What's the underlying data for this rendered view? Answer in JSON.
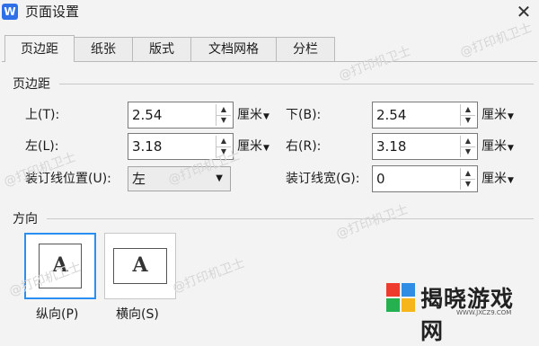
{
  "window": {
    "app_icon": "W",
    "title": "页面设置",
    "close": "✕"
  },
  "tabs": [
    "页边距",
    "纸张",
    "版式",
    "文档网格",
    "分栏"
  ],
  "margins_section": {
    "title": "页边距",
    "top_label": "上(T):",
    "top_value": "2.54",
    "bottom_label": "下(B):",
    "bottom_value": "2.54",
    "left_label": "左(L):",
    "left_value": "3.18",
    "right_label": "右(R):",
    "right_value": "3.18",
    "gutter_pos_label": "装订线位置(U):",
    "gutter_pos_value": "左",
    "gutter_width_label": "装订线宽(G):",
    "gutter_width_value": "0",
    "unit": "厘米"
  },
  "orientation_section": {
    "title": "方向",
    "portrait_label": "纵向(P)",
    "landscape_label": "横向(S)",
    "page_letter": "A"
  },
  "watermark": "@打印机卫士",
  "logo": {
    "text": "揭晓游戏网",
    "sub": "WWW.JXCZ9.COM"
  }
}
